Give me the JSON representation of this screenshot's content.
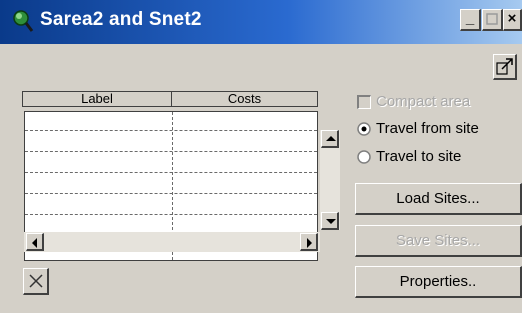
{
  "window": {
    "title": "Sarea2 and Snet2",
    "icons": {
      "app": "magnifier-globe-icon",
      "minimize": "minimize-icon",
      "maximize": "maximize-icon",
      "close": "close-icon"
    },
    "minimize_glyph": "_",
    "close_glyph": "×"
  },
  "toolbar": {
    "pin_icon": "pin-arrow-icon"
  },
  "list": {
    "columns": [
      "Label",
      "Costs"
    ],
    "rows": [
      {
        "label": "",
        "costs": ""
      },
      {
        "label": "",
        "costs": ""
      },
      {
        "label": "",
        "costs": ""
      },
      {
        "label": "",
        "costs": ""
      },
      {
        "label": "",
        "costs": ""
      },
      {
        "label": "",
        "costs": ""
      }
    ]
  },
  "options": {
    "compact_area": {
      "label": "Compact area",
      "checked": false,
      "enabled": false
    },
    "travel_from_site": {
      "label": "Travel from site",
      "selected": true
    },
    "travel_to_site": {
      "label": "Travel to site",
      "selected": false
    }
  },
  "buttons": {
    "load_sites": "Load Sites...",
    "save_sites": "Save Sites...",
    "properties": "Properties..",
    "delete_icon": "x-delete-icon"
  },
  "colors": {
    "titlebar_start": "#0a3a8a",
    "titlebar_end": "#a6caf0",
    "face": "#d4d0c8"
  }
}
